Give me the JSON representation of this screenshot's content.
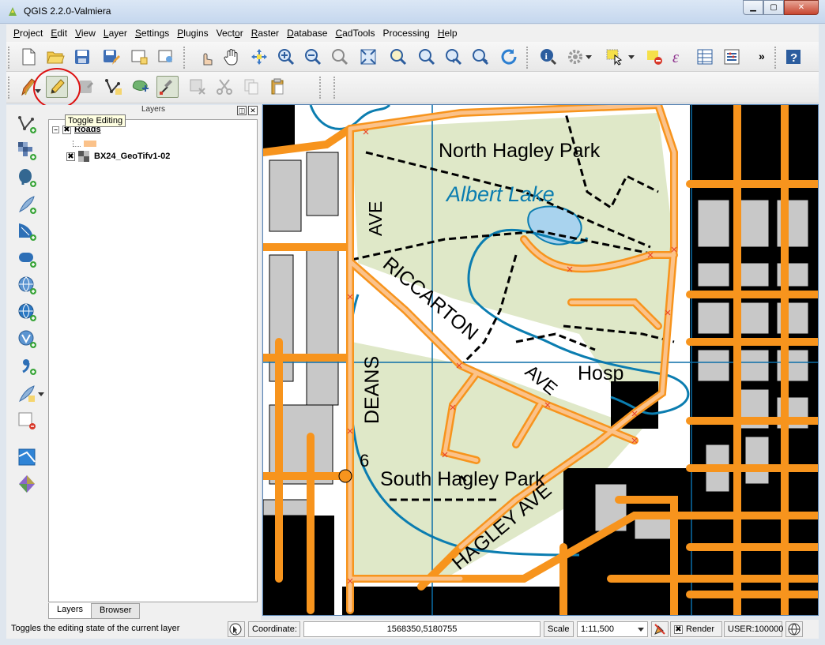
{
  "window": {
    "title": "QGIS 2.2.0-Valmiera",
    "min_label": "▁",
    "max_label": "▢",
    "close_label": "✕"
  },
  "menu": [
    {
      "label": "Project",
      "key": "P",
      "rest": "roject"
    },
    {
      "label": "Edit",
      "key": "E",
      "rest": "dit"
    },
    {
      "label": "View",
      "key": "V",
      "rest": "iew"
    },
    {
      "label": "Layer",
      "key": "L",
      "rest": "ayer"
    },
    {
      "label": "Settings",
      "key": "S",
      "rest": "ettings"
    },
    {
      "label": "Plugins",
      "key": "P",
      "rest": "lugins"
    },
    {
      "label": "Vector",
      "key": "o",
      "rest": "Vect|r"
    },
    {
      "label": "Raster",
      "key": "R",
      "rest": "aster"
    },
    {
      "label": "Database",
      "key": "D",
      "rest": "atabase"
    },
    {
      "label": "CadTools",
      "key": "C",
      "rest": "adTools"
    },
    {
      "label": "Processing",
      "key": "",
      "rest": "Processing"
    },
    {
      "label": "Help",
      "key": "H",
      "rest": "elp"
    }
  ],
  "toolbar": {
    "more_label": "»",
    "help_label": "?"
  },
  "tooltip": "Toggle Editing",
  "layers_panel": {
    "title": "Layers",
    "float_label": "◫",
    "close_label": "✕",
    "layers": [
      {
        "name": "Roads",
        "checked": "✖",
        "expander": "−"
      },
      {
        "name": "BX24_GeoTifv1-02",
        "checked": "✖"
      }
    ],
    "tabs": [
      "Layers",
      "Browser"
    ]
  },
  "map": {
    "labels": {
      "north_hagley": "North Hagley Park",
      "albert_lake": "Albert Lake",
      "ave_north": "AVE",
      "riccarton": "RICCARTON",
      "ave_mid": "AVE",
      "hosp": "Hosp",
      "deans": "DEANS",
      "six": "6",
      "south_hagley": "South Hagley Park",
      "hagley_ave": "HAGLEY AVE"
    },
    "colors": {
      "road": "#f7941d",
      "park": "#dfe8c8",
      "water": "#0b7db0",
      "building": "#000000",
      "selected_road": "#fbc28a"
    }
  },
  "statusbar": {
    "message": "Toggles the editing state of the current layer",
    "coordinate_label": "Coordinate:",
    "coordinate_value": "1568350,5180755",
    "scale_label": "Scale",
    "scale_value": "1:11,500",
    "render_label": "Render",
    "render_check": "✖",
    "crs_label": "USER:100000"
  }
}
